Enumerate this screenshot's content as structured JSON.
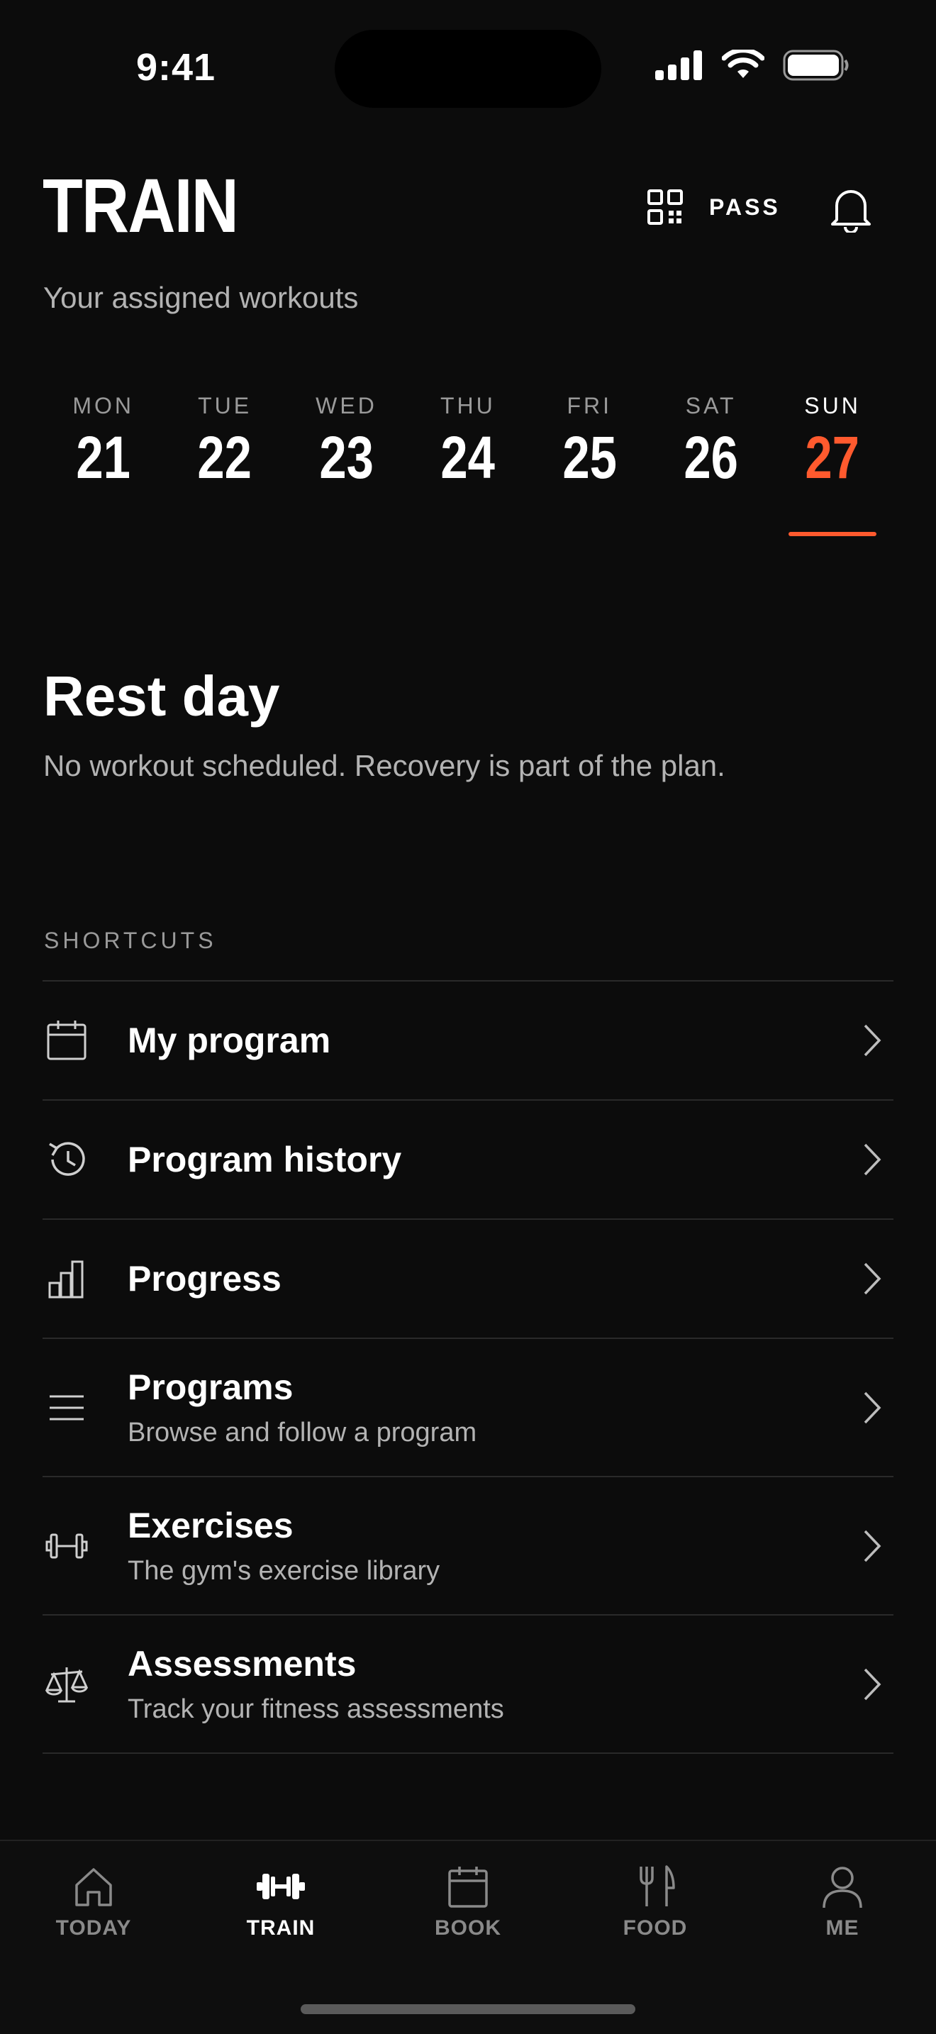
{
  "status_bar": {
    "time": "9:41"
  },
  "header": {
    "title": "TRAIN",
    "subtitle": "Your assigned workouts",
    "pass_label": "PASS"
  },
  "week": [
    {
      "name": "MON",
      "num": "21",
      "active": false
    },
    {
      "name": "TUE",
      "num": "22",
      "active": false
    },
    {
      "name": "WED",
      "num": "23",
      "active": false
    },
    {
      "name": "THU",
      "num": "24",
      "active": false
    },
    {
      "name": "FRI",
      "num": "25",
      "active": false
    },
    {
      "name": "SAT",
      "num": "26",
      "active": false
    },
    {
      "name": "SUN",
      "num": "27",
      "active": true
    }
  ],
  "rest": {
    "title": "Rest day",
    "description": "No workout scheduled. Recovery is part of the plan."
  },
  "shortcuts": {
    "label": "SHORTCUTS",
    "items": [
      {
        "icon": "calendar-icon",
        "label": "My program",
        "sub": ""
      },
      {
        "icon": "history-icon",
        "label": "Program history",
        "sub": ""
      },
      {
        "icon": "bar-chart-icon",
        "label": "Progress",
        "sub": ""
      },
      {
        "icon": "menu-lines-icon",
        "label": "Programs",
        "sub": "Browse and follow a program"
      },
      {
        "icon": "dumbbell-icon",
        "label": "Exercises",
        "sub": "The gym's exercise library"
      },
      {
        "icon": "scale-icon",
        "label": "Assessments",
        "sub": "Track your fitness assessments"
      }
    ]
  },
  "tabbar": [
    {
      "icon": "home-icon",
      "label": "TODAY",
      "active": false
    },
    {
      "icon": "dumbbell-icon",
      "label": "TRAIN",
      "active": true
    },
    {
      "icon": "calendar-icon",
      "label": "BOOK",
      "active": false
    },
    {
      "icon": "fork-knife-icon",
      "label": "FOOD",
      "active": false
    },
    {
      "icon": "person-icon",
      "label": "ME",
      "active": false
    }
  ],
  "colors": {
    "accent": "#ff5a2e",
    "background": "#0c0c0c",
    "muted": "#b3b3b3"
  }
}
